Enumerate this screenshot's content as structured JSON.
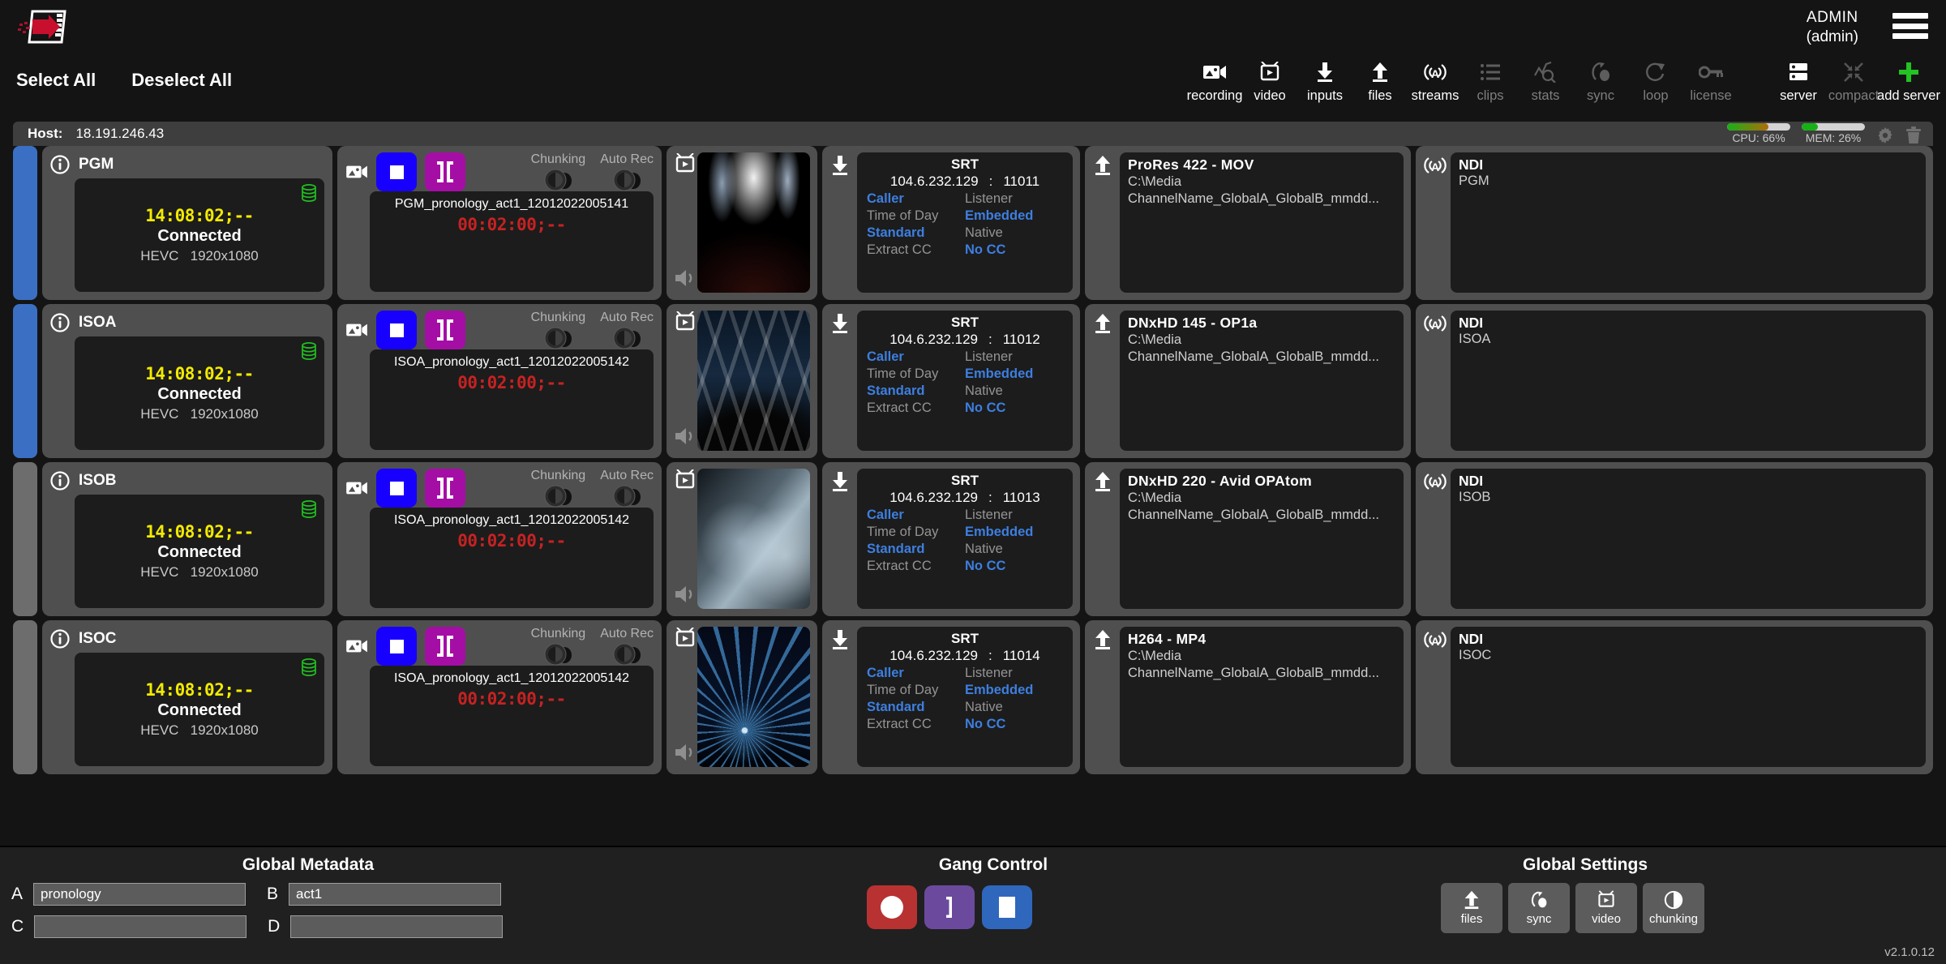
{
  "header": {
    "logo_name": "pronology-logo",
    "user_name": "ADMIN",
    "user_role": "(admin)"
  },
  "selectors": {
    "select_all": "Select All",
    "deselect_all": "Deselect All"
  },
  "toolbar": {
    "items": [
      {
        "icon": "recording-icon",
        "label": "recording",
        "state": "on"
      },
      {
        "icon": "video-icon",
        "label": "video",
        "state": "on"
      },
      {
        "icon": "inputs-icon",
        "label": "inputs",
        "state": "on"
      },
      {
        "icon": "files-icon",
        "label": "files",
        "state": "on"
      },
      {
        "icon": "streams-icon",
        "label": "streams",
        "state": "on"
      },
      {
        "icon": "clips-icon",
        "label": "clips",
        "state": "off"
      },
      {
        "icon": "stats-icon",
        "label": "stats",
        "state": "off"
      },
      {
        "icon": "sync-icon",
        "label": "sync",
        "state": "off"
      },
      {
        "icon": "loop-icon",
        "label": "loop",
        "state": "off"
      },
      {
        "icon": "license-icon",
        "label": "license",
        "state": "off"
      }
    ],
    "items_right": [
      {
        "icon": "server-icon",
        "label": "server",
        "state": "on"
      },
      {
        "icon": "compact-icon",
        "label": "compact",
        "state": "off"
      },
      {
        "icon": "add-server-icon",
        "label": "add server",
        "state": "accent"
      }
    ]
  },
  "host": {
    "label": "Host:",
    "address": "18.191.246.43",
    "cpu_label": "CPU: 66%",
    "cpu_pct": 66,
    "mem_label": "MEM: 26%",
    "mem_pct": 26,
    "settings_icon": "gear-icon",
    "delete_icon": "trash-icon"
  },
  "colors": {
    "selected_bar": "#3b6fc4",
    "unselected_bar": "#6d6d6d",
    "stop_button": "#1800ff",
    "mark_button": "#a50ea5",
    "timecode_yellow": "#f2ea00",
    "record_timecode_red": "#c62222",
    "link_blue": "#3d7fe0",
    "db_green": "#20c020",
    "add_server_green": "#22c322",
    "gang_record_red": "#b83232",
    "gang_mark_purple": "#6b4a9e",
    "gang_stop_blue": "#2f67bd"
  },
  "labels": {
    "chunking": "Chunking",
    "auto_rec": "Auto Rec",
    "srt_title": "SRT",
    "ndi_title": "NDI",
    "colon": ":"
  },
  "rows": [
    {
      "selected": true,
      "channel": {
        "name": "PGM",
        "timecode": "14:08:02;--",
        "status": "Connected",
        "codec": "HEVC",
        "resolution": "1920x1080"
      },
      "recording": {
        "filename": "PGM_pronology_act1_12012022005141",
        "timecode": "00:02:00;--"
      },
      "preview": {
        "thumb": "concert-crowd-lights"
      },
      "srt": {
        "address": "104.6.232.129",
        "port": "11011",
        "mode_active": "Caller",
        "mode_inactive": "Listener",
        "tc_inactive": "Time of Day",
        "tc_active": "Embedded",
        "latency_active": "Standard",
        "latency_inactive": "Native",
        "cc_inactive": "Extract CC",
        "cc_active": "No CC"
      },
      "output": {
        "format": "ProRes 422 - MOV",
        "path": "C:\\Media",
        "pattern": "ChannelName_GlobalA_GlobalB_mmdd..."
      },
      "ndi": {
        "title": "NDI",
        "source": "PGM"
      }
    },
    {
      "selected": true,
      "channel": {
        "name": "ISOA",
        "timecode": "14:08:02;--",
        "status": "Connected",
        "codec": "HEVC",
        "resolution": "1920x1080"
      },
      "recording": {
        "filename": "ISOA_pronology_act1_12012022005142",
        "timecode": "00:02:00;--"
      },
      "preview": {
        "thumb": "stage-beams"
      },
      "srt": {
        "address": "104.6.232.129",
        "port": "11012",
        "mode_active": "Caller",
        "mode_inactive": "Listener",
        "tc_inactive": "Time of Day",
        "tc_active": "Embedded",
        "latency_active": "Standard",
        "latency_inactive": "Native",
        "cc_inactive": "Extract CC",
        "cc_active": "No CC"
      },
      "output": {
        "format": "DNxHD 145 - OP1a",
        "path": "C:\\Media",
        "pattern": "ChannelName_GlobalA_GlobalB_mmdd..."
      },
      "ndi": {
        "title": "NDI",
        "source": "ISOA"
      }
    },
    {
      "selected": false,
      "channel": {
        "name": "ISOB",
        "timecode": "14:08:02;--",
        "status": "Connected",
        "codec": "HEVC",
        "resolution": "1920x1080"
      },
      "recording": {
        "filename": "ISOA_pronology_act1_12012022005142",
        "timecode": "00:02:00;--"
      },
      "preview": {
        "thumb": "guitar-closeup"
      },
      "srt": {
        "address": "104.6.232.129",
        "port": "11013",
        "mode_active": "Caller",
        "mode_inactive": "Listener",
        "tc_inactive": "Time of Day",
        "tc_active": "Embedded",
        "latency_active": "Standard",
        "latency_inactive": "Native",
        "cc_inactive": "Extract CC",
        "cc_active": "No CC"
      },
      "output": {
        "format": "DNxHD 220 - Avid OPAtom",
        "path": "C:\\Media",
        "pattern": "ChannelName_GlobalA_GlobalB_mmdd..."
      },
      "ndi": {
        "title": "NDI",
        "source": "ISOB"
      }
    },
    {
      "selected": false,
      "channel": {
        "name": "ISOC",
        "timecode": "14:08:02;--",
        "status": "Connected",
        "codec": "HEVC",
        "resolution": "1920x1080"
      },
      "recording": {
        "filename": "ISOA_pronology_act1_12012022005142",
        "timecode": "00:02:00;--"
      },
      "preview": {
        "thumb": "blue-laser-arena"
      },
      "srt": {
        "address": "104.6.232.129",
        "port": "11014",
        "mode_active": "Caller",
        "mode_inactive": "Listener",
        "tc_inactive": "Time of Day",
        "tc_active": "Embedded",
        "latency_active": "Standard",
        "latency_inactive": "Native",
        "cc_inactive": "Extract CC",
        "cc_active": "No CC"
      },
      "output": {
        "format": "H264 - MP4",
        "path": "C:\\Media",
        "pattern": "ChannelName_GlobalA_GlobalB_mmdd..."
      },
      "ndi": {
        "title": "NDI",
        "source": "ISOC"
      }
    }
  ],
  "global_metadata": {
    "title": "Global Metadata",
    "fields": [
      {
        "label": "A",
        "value": "pronology",
        "placeholder": ""
      },
      {
        "label": "B",
        "value": "act1",
        "placeholder": ""
      },
      {
        "label": "C",
        "value": "",
        "placeholder": ""
      },
      {
        "label": "D",
        "value": "",
        "placeholder": ""
      }
    ]
  },
  "gang_control": {
    "title": "Gang Control",
    "buttons": [
      {
        "icon": "record-icon",
        "name": "gang-record-button"
      },
      {
        "icon": "mark-icon",
        "name": "gang-mark-button"
      },
      {
        "icon": "stop-icon",
        "name": "gang-stop-button"
      }
    ]
  },
  "global_settings": {
    "title": "Global Settings",
    "buttons": [
      {
        "icon": "files-icon",
        "label": "files"
      },
      {
        "icon": "sync-icon",
        "label": "sync"
      },
      {
        "icon": "video-icon",
        "label": "video"
      },
      {
        "icon": "chunking-icon",
        "label": "chunking"
      }
    ]
  },
  "version": "v2.1.0.12"
}
